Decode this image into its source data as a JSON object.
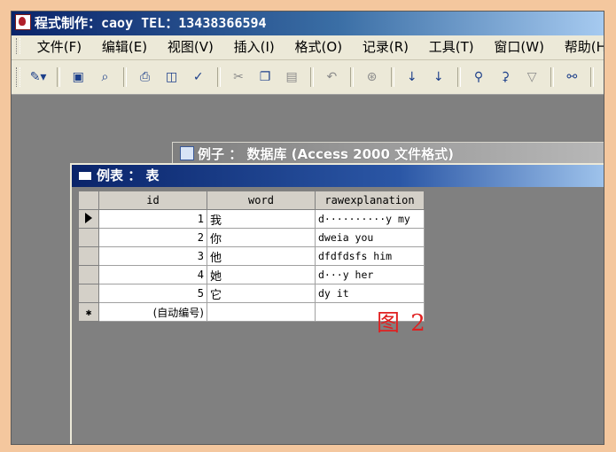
{
  "window": {
    "title": "程式制作：caoy TEL：13438366594"
  },
  "menu": {
    "items": [
      "文件(F)",
      "编辑(E)",
      "视图(V)",
      "插入(I)",
      "格式(O)",
      "记录(R)",
      "工具(T)",
      "窗口(W)",
      "帮助(H)"
    ]
  },
  "toolbar": {
    "icons": [
      "design-view-icon",
      "save-icon",
      "find-file-icon",
      "print-icon",
      "print-preview-icon",
      "spelling-icon",
      "cut-icon",
      "copy-icon",
      "paste-icon",
      "undo-icon",
      "hyperlink-icon",
      "sort-ascending-icon",
      "sort-descending-icon",
      "filter-by-selection-icon",
      "filter-by-form-icon",
      "apply-filter-icon",
      "find-icon",
      "new-record-icon",
      "delete-record-icon"
    ]
  },
  "db_window": {
    "title": "例子 ： 数据库 (Access 2000 文件格式)"
  },
  "table_window": {
    "title": "例表 ： 表",
    "columns": [
      "id",
      "word",
      "rawexplanation"
    ],
    "rows": [
      {
        "id": "1",
        "word": "我",
        "rawexplanation": "d··········y my"
      },
      {
        "id": "2",
        "word": "你",
        "rawexplanation": "dweia you"
      },
      {
        "id": "3",
        "word": "他",
        "rawexplanation": "dfdfdsfs him"
      },
      {
        "id": "4",
        "word": "她",
        "rawexplanation": "d···y her"
      },
      {
        "id": "5",
        "word": "它",
        "rawexplanation": "dy it"
      }
    ],
    "new_row": {
      "marker": "✱",
      "id": "(自动编号)"
    }
  },
  "annotation": {
    "text": "图 2",
    "color": "#e02020"
  }
}
